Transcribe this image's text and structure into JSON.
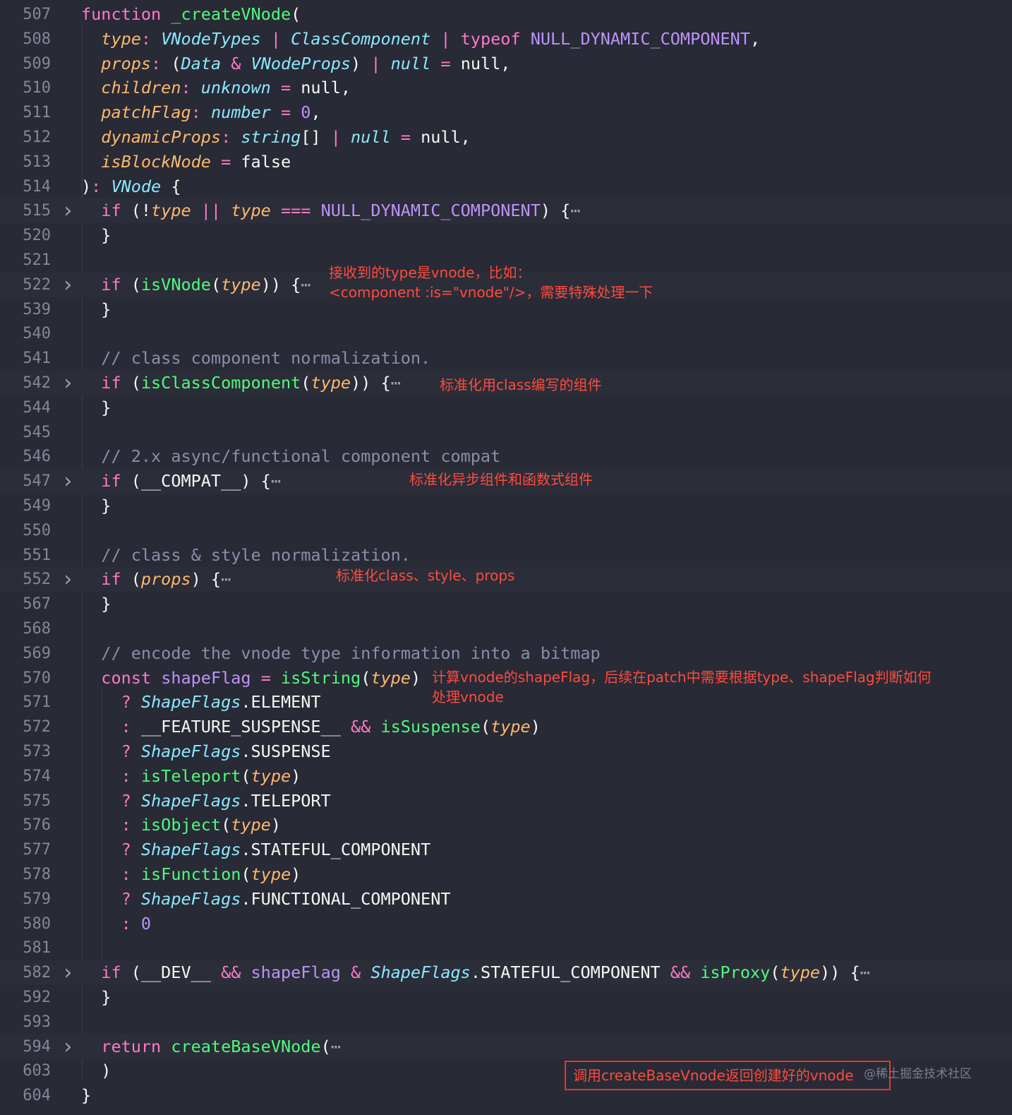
{
  "editor": {
    "theme_colors": {
      "background": "#282a36",
      "keyword": "#ff79c6",
      "function": "#50fa7b",
      "type": "#8be9fd",
      "parameter": "#ffb86c",
      "constant": "#bd93f9",
      "comment": "#8a8fa8",
      "annotation": "#ff4b3c"
    },
    "fold_icon": "chevron-right-icon",
    "lines": [
      {
        "no": "507",
        "fold": false,
        "tokens": [
          [
            "kw",
            "function "
          ],
          [
            "fn",
            "_createVNode"
          ],
          [
            "plain",
            "("
          ]
        ]
      },
      {
        "no": "508",
        "fold": false,
        "tokens": [
          [
            "plain",
            "  "
          ],
          [
            "param",
            "type"
          ],
          [
            "op",
            ": "
          ],
          [
            "cls",
            "VNodeTypes"
          ],
          [
            "op",
            " | "
          ],
          [
            "cls",
            "ClassComponent"
          ],
          [
            "op",
            " | "
          ],
          [
            "kw",
            "typeof "
          ],
          [
            "const",
            "NULL_DYNAMIC_COMPONENT"
          ],
          [
            "plain",
            ","
          ]
        ]
      },
      {
        "no": "509",
        "fold": false,
        "tokens": [
          [
            "plain",
            "  "
          ],
          [
            "param",
            "props"
          ],
          [
            "op",
            ": "
          ],
          [
            "plain",
            "("
          ],
          [
            "cls",
            "Data"
          ],
          [
            "op",
            " & "
          ],
          [
            "cls",
            "VNodeProps"
          ],
          [
            "plain",
            ")"
          ],
          [
            "op",
            " | "
          ],
          [
            "cls",
            "null"
          ],
          [
            "op",
            " = "
          ],
          [
            "plain",
            "null,"
          ]
        ]
      },
      {
        "no": "510",
        "fold": false,
        "tokens": [
          [
            "plain",
            "  "
          ],
          [
            "param",
            "children"
          ],
          [
            "op",
            ": "
          ],
          [
            "cls",
            "unknown"
          ],
          [
            "op",
            " = "
          ],
          [
            "plain",
            "null,"
          ]
        ]
      },
      {
        "no": "511",
        "fold": false,
        "tokens": [
          [
            "plain",
            "  "
          ],
          [
            "param",
            "patchFlag"
          ],
          [
            "op",
            ": "
          ],
          [
            "cls",
            "number"
          ],
          [
            "op",
            " = "
          ],
          [
            "const",
            "0"
          ],
          [
            "plain",
            ","
          ]
        ]
      },
      {
        "no": "512",
        "fold": false,
        "tokens": [
          [
            "plain",
            "  "
          ],
          [
            "param",
            "dynamicProps"
          ],
          [
            "op",
            ": "
          ],
          [
            "cls",
            "string"
          ],
          [
            "plain",
            "[]"
          ],
          [
            "op",
            " | "
          ],
          [
            "cls",
            "null"
          ],
          [
            "op",
            " = "
          ],
          [
            "plain",
            "null,"
          ]
        ]
      },
      {
        "no": "513",
        "fold": false,
        "tokens": [
          [
            "plain",
            "  "
          ],
          [
            "param",
            "isBlockNode"
          ],
          [
            "op",
            " = "
          ],
          [
            "plain",
            "false"
          ]
        ]
      },
      {
        "no": "514",
        "fold": false,
        "tokens": [
          [
            "plain",
            ")"
          ],
          [
            "op",
            ": "
          ],
          [
            "cls",
            "VNode"
          ],
          [
            "plain",
            " {"
          ]
        ]
      },
      {
        "no": "515",
        "fold": true,
        "tokens": [
          [
            "plain",
            "  "
          ],
          [
            "kw",
            "if"
          ],
          [
            "plain",
            " (!"
          ],
          [
            "param",
            "type"
          ],
          [
            "op",
            " || "
          ],
          [
            "param",
            "type"
          ],
          [
            "op",
            " === "
          ],
          [
            "const",
            "NULL_DYNAMIC_COMPONENT"
          ],
          [
            "plain",
            ") {"
          ],
          [
            "ellipsis",
            "⋯"
          ]
        ]
      },
      {
        "no": "520",
        "fold": false,
        "tokens": [
          [
            "plain",
            "  }"
          ]
        ]
      },
      {
        "no": "521",
        "fold": false,
        "tokens": []
      },
      {
        "no": "522",
        "fold": true,
        "tokens": [
          [
            "plain",
            "  "
          ],
          [
            "kw",
            "if"
          ],
          [
            "plain",
            " ("
          ],
          [
            "fn",
            "isVNode"
          ],
          [
            "plain",
            "("
          ],
          [
            "param",
            "type"
          ],
          [
            "plain",
            ")) {"
          ],
          [
            "ellipsis",
            "⋯"
          ]
        ]
      },
      {
        "no": "539",
        "fold": false,
        "tokens": [
          [
            "plain",
            "  }"
          ]
        ]
      },
      {
        "no": "540",
        "fold": false,
        "tokens": []
      },
      {
        "no": "541",
        "fold": false,
        "tokens": [
          [
            "comment",
            "  // class component normalization."
          ]
        ]
      },
      {
        "no": "542",
        "fold": true,
        "tokens": [
          [
            "plain",
            "  "
          ],
          [
            "kw",
            "if"
          ],
          [
            "plain",
            " ("
          ],
          [
            "fn",
            "isClassComponent"
          ],
          [
            "plain",
            "("
          ],
          [
            "param",
            "type"
          ],
          [
            "plain",
            ")) {"
          ],
          [
            "ellipsis",
            "⋯"
          ]
        ]
      },
      {
        "no": "544",
        "fold": false,
        "tokens": [
          [
            "plain",
            "  }"
          ]
        ]
      },
      {
        "no": "545",
        "fold": false,
        "tokens": []
      },
      {
        "no": "546",
        "fold": false,
        "tokens": [
          [
            "comment",
            "  // 2.x async/functional component compat"
          ]
        ]
      },
      {
        "no": "547",
        "fold": true,
        "tokens": [
          [
            "plain",
            "  "
          ],
          [
            "kw",
            "if"
          ],
          [
            "plain",
            " (__COMPAT__) {"
          ],
          [
            "ellipsis",
            "⋯"
          ]
        ]
      },
      {
        "no": "549",
        "fold": false,
        "tokens": [
          [
            "plain",
            "  }"
          ]
        ]
      },
      {
        "no": "550",
        "fold": false,
        "tokens": []
      },
      {
        "no": "551",
        "fold": false,
        "tokens": [
          [
            "comment",
            "  // class & style normalization."
          ]
        ]
      },
      {
        "no": "552",
        "fold": true,
        "tokens": [
          [
            "plain",
            "  "
          ],
          [
            "kw",
            "if"
          ],
          [
            "plain",
            " ("
          ],
          [
            "param",
            "props"
          ],
          [
            "plain",
            ") {"
          ],
          [
            "ellipsis",
            "⋯"
          ]
        ]
      },
      {
        "no": "567",
        "fold": false,
        "tokens": [
          [
            "plain",
            "  }"
          ]
        ]
      },
      {
        "no": "568",
        "fold": false,
        "tokens": []
      },
      {
        "no": "569",
        "fold": false,
        "tokens": [
          [
            "comment",
            "  // encode the vnode type information into a bitmap"
          ]
        ]
      },
      {
        "no": "570",
        "fold": false,
        "tokens": [
          [
            "plain",
            "  "
          ],
          [
            "kw",
            "const"
          ],
          [
            "plain",
            " "
          ],
          [
            "const",
            "shapeFlag"
          ],
          [
            "op",
            " = "
          ],
          [
            "fn",
            "isString"
          ],
          [
            "plain",
            "("
          ],
          [
            "param",
            "type"
          ],
          [
            "plain",
            ")"
          ]
        ]
      },
      {
        "no": "571",
        "fold": false,
        "tokens": [
          [
            "plain",
            "    "
          ],
          [
            "op",
            "? "
          ],
          [
            "cls",
            "ShapeFlags"
          ],
          [
            "plain",
            ".ELEMENT"
          ]
        ]
      },
      {
        "no": "572",
        "fold": false,
        "tokens": [
          [
            "plain",
            "    "
          ],
          [
            "op",
            ": "
          ],
          [
            "plain",
            "__FEATURE_SUSPENSE__"
          ],
          [
            "op",
            " && "
          ],
          [
            "fn",
            "isSuspense"
          ],
          [
            "plain",
            "("
          ],
          [
            "param",
            "type"
          ],
          [
            "plain",
            ")"
          ]
        ]
      },
      {
        "no": "573",
        "fold": false,
        "tokens": [
          [
            "plain",
            "    "
          ],
          [
            "op",
            "? "
          ],
          [
            "cls",
            "ShapeFlags"
          ],
          [
            "plain",
            ".SUSPENSE"
          ]
        ]
      },
      {
        "no": "574",
        "fold": false,
        "tokens": [
          [
            "plain",
            "    "
          ],
          [
            "op",
            ": "
          ],
          [
            "fn",
            "isTeleport"
          ],
          [
            "plain",
            "("
          ],
          [
            "param",
            "type"
          ],
          [
            "plain",
            ")"
          ]
        ]
      },
      {
        "no": "575",
        "fold": false,
        "tokens": [
          [
            "plain",
            "    "
          ],
          [
            "op",
            "? "
          ],
          [
            "cls",
            "ShapeFlags"
          ],
          [
            "plain",
            ".TELEPORT"
          ]
        ]
      },
      {
        "no": "576",
        "fold": false,
        "tokens": [
          [
            "plain",
            "    "
          ],
          [
            "op",
            ": "
          ],
          [
            "fn",
            "isObject"
          ],
          [
            "plain",
            "("
          ],
          [
            "param",
            "type"
          ],
          [
            "plain",
            ")"
          ]
        ]
      },
      {
        "no": "577",
        "fold": false,
        "tokens": [
          [
            "plain",
            "    "
          ],
          [
            "op",
            "? "
          ],
          [
            "cls",
            "ShapeFlags"
          ],
          [
            "plain",
            ".STATEFUL_COMPONENT"
          ]
        ]
      },
      {
        "no": "578",
        "fold": false,
        "tokens": [
          [
            "plain",
            "    "
          ],
          [
            "op",
            ": "
          ],
          [
            "fn",
            "isFunction"
          ],
          [
            "plain",
            "("
          ],
          [
            "param",
            "type"
          ],
          [
            "plain",
            ")"
          ]
        ]
      },
      {
        "no": "579",
        "fold": false,
        "tokens": [
          [
            "plain",
            "    "
          ],
          [
            "op",
            "? "
          ],
          [
            "cls",
            "ShapeFlags"
          ],
          [
            "plain",
            ".FUNCTIONAL_COMPONENT"
          ]
        ]
      },
      {
        "no": "580",
        "fold": false,
        "tokens": [
          [
            "plain",
            "    "
          ],
          [
            "op",
            ": "
          ],
          [
            "const",
            "0"
          ]
        ]
      },
      {
        "no": "581",
        "fold": false,
        "tokens": []
      },
      {
        "no": "582",
        "fold": true,
        "tokens": [
          [
            "plain",
            "  "
          ],
          [
            "kw",
            "if"
          ],
          [
            "plain",
            " (__DEV__"
          ],
          [
            "op",
            " && "
          ],
          [
            "const",
            "shapeFlag"
          ],
          [
            "op",
            " & "
          ],
          [
            "cls",
            "ShapeFlags"
          ],
          [
            "plain",
            ".STATEFUL_COMPONENT"
          ],
          [
            "op",
            " && "
          ],
          [
            "fn",
            "isProxy"
          ],
          [
            "plain",
            "("
          ],
          [
            "param",
            "type"
          ],
          [
            "plain",
            ")) {"
          ],
          [
            "ellipsis",
            "⋯"
          ]
        ]
      },
      {
        "no": "592",
        "fold": false,
        "tokens": [
          [
            "plain",
            "  }"
          ]
        ]
      },
      {
        "no": "593",
        "fold": false,
        "tokens": []
      },
      {
        "no": "594",
        "fold": true,
        "tokens": [
          [
            "plain",
            "  "
          ],
          [
            "kw",
            "return"
          ],
          [
            "plain",
            " "
          ],
          [
            "fn",
            "createBaseVNode"
          ],
          [
            "plain",
            "("
          ],
          [
            "ellipsis",
            "⋯"
          ]
        ]
      },
      {
        "no": "603",
        "fold": false,
        "tokens": [
          [
            "plain",
            "  )"
          ]
        ]
      },
      {
        "no": "604",
        "fold": false,
        "tokens": [
          [
            "plain",
            "}"
          ]
        ]
      }
    ]
  },
  "annotations": {
    "vnode_note": "接收到的type是vnode，比如：\n<component :is=\"vnode\"/>，需要特殊处理一下",
    "class_note": "标准化用class编写的组件",
    "compat_note": "标准化异步组件和函数式组件",
    "props_note": "标准化class、style、props",
    "shapeflag_note": "计算vnode的shapeFlag，后续在patch中需要根据type、shapeFlag判断如何\n处理vnode",
    "return_note": "调用createBaseVnode返回创建好的vnode"
  },
  "watermark": "@稀土掘金技术社区"
}
